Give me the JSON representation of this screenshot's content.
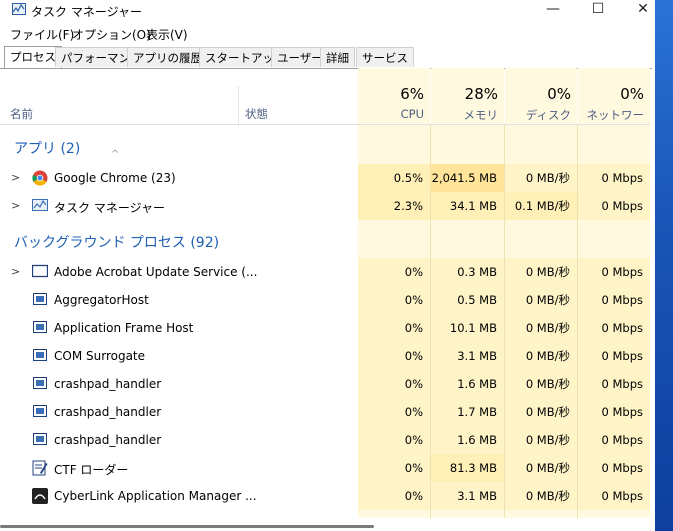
{
  "window": {
    "title": "タスク マネージャー",
    "controls": {
      "minimize": "—",
      "maximize": "☐",
      "close": "✕"
    }
  },
  "menu": [
    "ファイル(F)",
    "オプション(O)",
    "表示(V)"
  ],
  "tabs": [
    "プロセス",
    "パフォーマンス",
    "アプリの履歴",
    "スタートアップ",
    "ユーザー",
    "詳細",
    "サービス"
  ],
  "header": {
    "name": "名前",
    "status": "状態",
    "cpu": {
      "pct": "6%",
      "label": "CPU"
    },
    "memory": {
      "pct": "28%",
      "label": "メモリ"
    },
    "disk": {
      "pct": "0%",
      "label": "ディスク"
    },
    "network": {
      "pct": "0%",
      "label": "ネットワーク"
    }
  },
  "groups": {
    "apps": "アプリ (2)",
    "background": "バックグラウンド プロセス (92)"
  },
  "apps": [
    {
      "name": "Google Chrome (23)",
      "icon": "chrome-icon",
      "cpu": "0.5%",
      "mem": "2,041.5 MB",
      "disk": "0 MB/秒",
      "net": "0 Mbps"
    },
    {
      "name": "タスク マネージャー",
      "icon": "task-manager-icon",
      "cpu": "2.3%",
      "mem": "34.1 MB",
      "disk": "0.1 MB/秒",
      "net": "0 Mbps"
    }
  ],
  "background": [
    {
      "name": "Adobe Acrobat Update Service (...",
      "icon": "acrobat-update-icon",
      "cpu": "0%",
      "mem": "0.3 MB",
      "disk": "0 MB/秒",
      "net": "0 Mbps"
    },
    {
      "name": "AggregatorHost",
      "icon": "window-icon",
      "cpu": "0%",
      "mem": "0.5 MB",
      "disk": "0 MB/秒",
      "net": "0 Mbps"
    },
    {
      "name": "Application Frame Host",
      "icon": "window-icon",
      "cpu": "0%",
      "mem": "10.1 MB",
      "disk": "0 MB/秒",
      "net": "0 Mbps"
    },
    {
      "name": "COM Surrogate",
      "icon": "window-icon",
      "cpu": "0%",
      "mem": "3.1 MB",
      "disk": "0 MB/秒",
      "net": "0 Mbps"
    },
    {
      "name": "crashpad_handler",
      "icon": "window-icon",
      "cpu": "0%",
      "mem": "1.6 MB",
      "disk": "0 MB/秒",
      "net": "0 Mbps"
    },
    {
      "name": "crashpad_handler",
      "icon": "window-icon",
      "cpu": "0%",
      "mem": "1.7 MB",
      "disk": "0 MB/秒",
      "net": "0 Mbps"
    },
    {
      "name": "crashpad_handler",
      "icon": "window-icon",
      "cpu": "0%",
      "mem": "1.6 MB",
      "disk": "0 MB/秒",
      "net": "0 Mbps"
    },
    {
      "name": "CTF ローダー",
      "icon": "ctf-loader-icon",
      "cpu": "0%",
      "mem": "81.3 MB",
      "disk": "0 MB/秒",
      "net": "0 Mbps"
    },
    {
      "name": "CyberLink Application Manager ...",
      "icon": "cyberlink-icon",
      "cpu": "0%",
      "mem": "3.1 MB",
      "disk": "0 MB/秒",
      "net": "0 Mbps"
    }
  ],
  "colors": {
    "accent": "#1e5fb4",
    "cpu_bg": "#fff4c4",
    "mem_bg_high": "#ffe7a0",
    "col_bg": "#fff9e0"
  }
}
